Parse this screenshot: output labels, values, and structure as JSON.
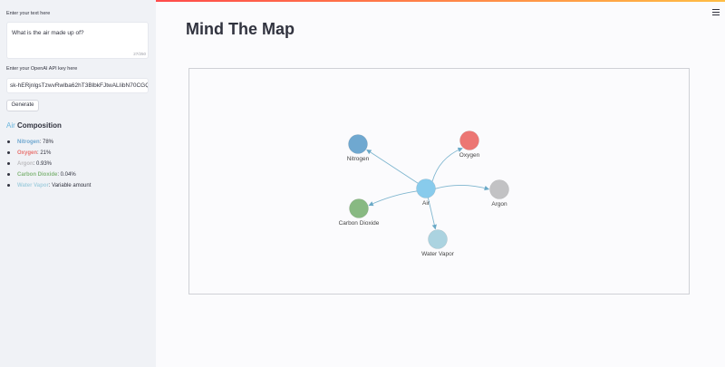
{
  "sidebar": {
    "text_label": "Enter your text here",
    "text_value": "What is the air made up of?",
    "char_count": "27/250",
    "api_label": "Enter your OpenAI API key here",
    "api_value": "sk-hERjnlgsTzwvRwlba62hT3BlbkFJtwALIibN70CGQhj6",
    "generate_label": "Generate",
    "heading_accent": "Air",
    "heading_rest": " Composition",
    "components": [
      {
        "name": "Nitrogen",
        "value": ": 78%",
        "color": "#6fa8d0"
      },
      {
        "name": "Oxygen",
        "value": ": 21%",
        "color": "#e87370"
      },
      {
        "name": "Argon",
        "value": ": 0.93%",
        "color": "#bdbdc0"
      },
      {
        "name": "Carbon Dioxide",
        "value": ": 0.04%",
        "color": "#86b87e"
      },
      {
        "name": "Water Vapor",
        "value": ": Variable amount",
        "color": "#a6d0df"
      }
    ]
  },
  "main": {
    "title": "Mind The Map"
  },
  "graph": {
    "nodes": [
      {
        "id": "air",
        "label": "Air",
        "color": "#88cbec"
      },
      {
        "id": "nitrogen",
        "label": "Nitrogen",
        "color": "#6fa8d0"
      },
      {
        "id": "oxygen",
        "label": "Oxygen",
        "color": "#ec7673"
      },
      {
        "id": "argon",
        "label": "Argon",
        "color": "#c2c2c4"
      },
      {
        "id": "co2",
        "label": "Carbon Dioxide",
        "color": "#88b982"
      },
      {
        "id": "water",
        "label": "Water Vapor",
        "color": "#abd3e0"
      }
    ],
    "edges": [
      {
        "from": "air",
        "to": "nitrogen"
      },
      {
        "from": "air",
        "to": "oxygen"
      },
      {
        "from": "air",
        "to": "argon"
      },
      {
        "from": "air",
        "to": "co2"
      },
      {
        "from": "air",
        "to": "water"
      }
    ],
    "edge_color": "#7fb6cf"
  },
  "icons": {
    "menu": "hamburger-menu-icon"
  }
}
